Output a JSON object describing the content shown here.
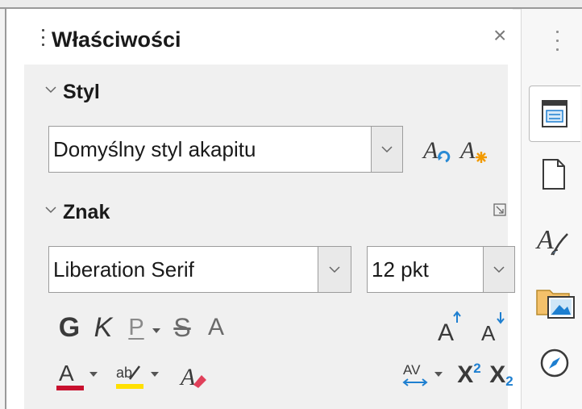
{
  "panel": {
    "title": "Właściwości",
    "close_glyph": "×"
  },
  "styl": {
    "heading": "Styl",
    "paragraph_style_value": "Domyślny styl akapitu"
  },
  "znak": {
    "heading": "Znak",
    "font_name_value": "Liberation Serif",
    "font_size_value": "12 pkt",
    "bold_label": "G",
    "italic_label": "K",
    "underline_label": "P",
    "strikethrough_label": "S",
    "shadow_label": "A",
    "superscript_label": "X",
    "superscript_mark": "2",
    "subscript_label": "X",
    "subscript_mark": "2",
    "spacing_label": "AV"
  },
  "colors": {
    "accent_blue": "#1e7fd0",
    "font_color": "#c8102e",
    "highlight_color": "#ffe000",
    "update_style_icon_color": "#2a8ad4",
    "new_style_icon_color": "#f29a00"
  },
  "icons": {
    "close": "close-icon",
    "collapse_section": "chevron-down-icon",
    "update_style": "update-style-icon",
    "new_style": "new-style-icon",
    "more_options": "more-options-icon",
    "grow_font": "increase-font-size-icon",
    "shrink_font": "decrease-font-size-icon",
    "font_color": "font-color-icon",
    "highlight": "highlighting-color-icon",
    "clear_formatting": "clear-direct-formatting-icon",
    "character_spacing": "character-spacing-icon",
    "tab_properties": "properties-tab-icon",
    "tab_page": "page-tab-icon",
    "tab_styles": "styles-tab-icon",
    "tab_gallery": "gallery-tab-icon",
    "tab_navigator": "navigator-tab-icon"
  }
}
